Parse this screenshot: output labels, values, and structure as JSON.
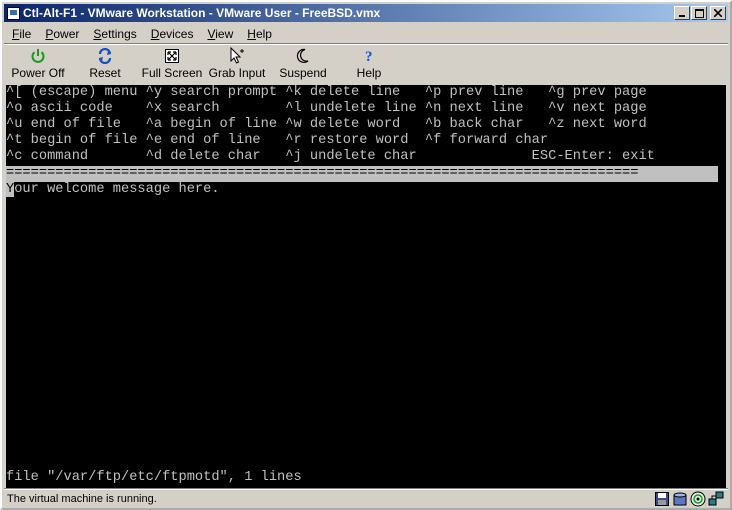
{
  "window": {
    "title": "Ctl-Alt-F1 - VMware Workstation - VMware User - FreeBSD.vmx"
  },
  "menu": [
    {
      "accel": "F",
      "rest": "ile"
    },
    {
      "accel": "P",
      "rest": "ower"
    },
    {
      "accel": "S",
      "rest": "ettings"
    },
    {
      "accel": "D",
      "rest": "evices"
    },
    {
      "accel": "V",
      "rest": "iew"
    },
    {
      "accel": "H",
      "rest": "elp"
    }
  ],
  "toolbar": {
    "power_off": "Power Off",
    "reset": "Reset",
    "full_screen": "Full Screen",
    "grab_input": "Grab Input",
    "suspend": "Suspend",
    "help": "Help"
  },
  "terminal": {
    "help_lines": [
      "^[ (escape) menu ^y search prompt ^k delete line   ^p prev line   ^g prev page",
      "^o ascii code    ^x search        ^l undelete line ^n next line   ^v next page",
      "^u end of file   ^a begin of line ^w delete word   ^b back char   ^z next word",
      "^t begin of file ^e end of line   ^r restore word  ^f forward char",
      "^c command       ^d delete char   ^j undelete char              ESC-Enter: exit"
    ],
    "rule": "=============================================================================",
    "cursor_char": "Y",
    "content_rest": "our welcome message here.",
    "status_line": "file \"/var/ftp/etc/ftpmotd\", 1 lines"
  },
  "statusbar": {
    "text": "The virtual machine is running."
  },
  "icons": {
    "power": "power-icon",
    "reset": "reset-icon",
    "fullscreen": "fullscreen-icon",
    "grab": "grab-cursor-icon",
    "suspend": "moon-icon",
    "help": "question-icon",
    "floppy": "floppy-disk-icon",
    "disk": "hard-disk-icon",
    "cdrom": "cd-rom-icon",
    "network": "network-icon"
  },
  "colors": {
    "title_start": "#0a246a",
    "title_end": "#a6caf0",
    "terminal_bg": "#000000",
    "terminal_fg": "#c0c0c0"
  }
}
